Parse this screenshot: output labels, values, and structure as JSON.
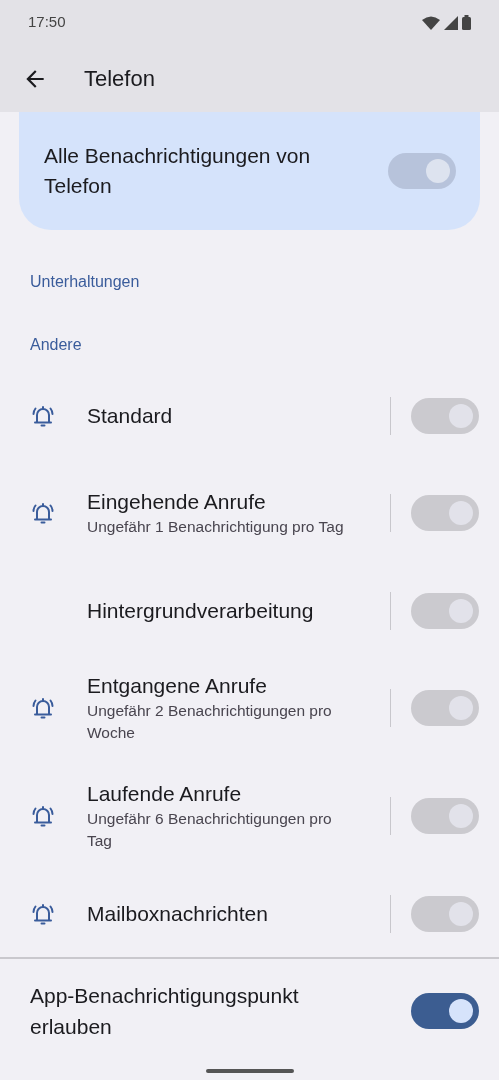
{
  "status_bar": {
    "time": "17:50"
  },
  "app_bar": {
    "title": "Telefon"
  },
  "master": {
    "label": "Alle Benachrichtigungen von Telefon",
    "on": true,
    "disabled": true
  },
  "sections": [
    {
      "header": "Unterhaltungen"
    },
    {
      "header": "Andere",
      "channels": [
        {
          "title": "Standard",
          "alerting": true,
          "on": true,
          "disabled": true
        },
        {
          "title": "Eingehende Anrufe",
          "summary": "Ungefähr 1 Benachrichtigung pro Tag",
          "alerting": true,
          "on": true,
          "disabled": true
        },
        {
          "title": "Hintergrundverarbeitung",
          "alerting": false,
          "on": true,
          "disabled": true
        },
        {
          "title": "Entgangene Anrufe",
          "summary": "Ungefähr 2 Benachrichtigungen pro Woche",
          "alerting": true,
          "on": true,
          "disabled": true
        },
        {
          "title": "Laufende Anrufe",
          "summary": "Ungefähr 6 Benachrichtigungen pro Tag",
          "alerting": true,
          "on": true,
          "disabled": true
        },
        {
          "title": "Mailboxnachrichten",
          "alerting": true,
          "on": true,
          "disabled": true
        }
      ]
    }
  ],
  "footer_setting": {
    "label": "App-Benachrichtigungspunkt erlauben",
    "on": true,
    "disabled": false
  }
}
